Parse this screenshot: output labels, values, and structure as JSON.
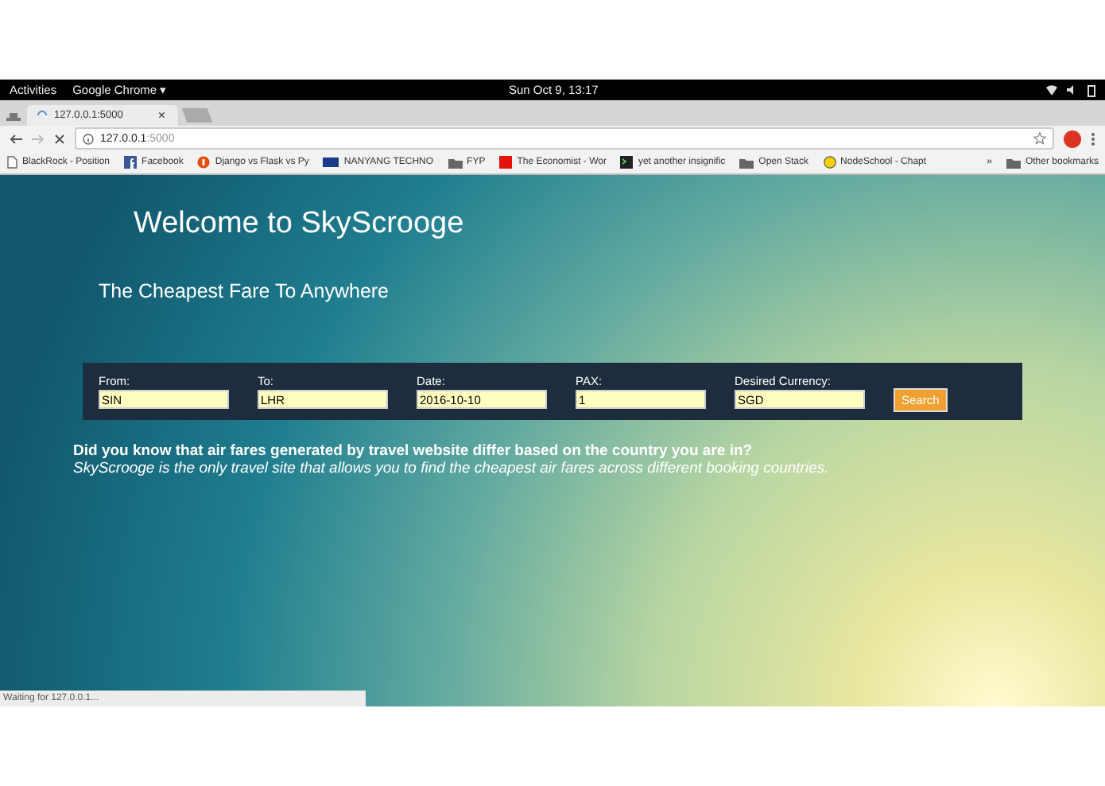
{
  "top_bar": {
    "activities": "Activities",
    "app": "Google Chrome ▾",
    "clock": "Sun Oct  9, 13:17"
  },
  "tabs": [
    {
      "title": "127.0.0.1:5000",
      "close": "×",
      "selected": true
    }
  ],
  "address_bar": {
    "host": "127.0.0.1",
    "port": ":5000"
  },
  "bookmarks": [
    {
      "label": "BlackRock - Position",
      "kind": "page"
    },
    {
      "label": "Facebook",
      "kind": "facebook"
    },
    {
      "label": "Django vs Flask vs Py",
      "kind": "circle"
    },
    {
      "label": "NANYANG TECHNO",
      "kind": "ntu"
    },
    {
      "label": "FYP",
      "kind": "folder"
    },
    {
      "label": "The Economist - Wor",
      "kind": "square"
    },
    {
      "label": "yet another insignific",
      "kind": "terminal"
    },
    {
      "label": "Open Stack",
      "kind": "folder"
    },
    {
      "label": "NodeSchool - Chapt",
      "kind": "dot"
    }
  ],
  "bookmarks_more": "»",
  "other_bookmarks": "Other bookmarks",
  "page": {
    "title": "Welcome to SkyScrooge",
    "subtitle": "The Cheapest Fare To Anywhere",
    "form": {
      "fields": [
        {
          "label": "From:",
          "value": "SIN"
        },
        {
          "label": "To:",
          "value": "LHR"
        },
        {
          "label": "Date:",
          "value": "2016-10-10"
        },
        {
          "label": "PAX:",
          "value": "1"
        },
        {
          "label": "Desired Currency:",
          "value": "SGD"
        }
      ],
      "button": "Search"
    },
    "question": "Did you know that air fares generated by travel website differ based on the country you are in?",
    "tagline": "SkyScrooge is the only travel site that allows you to find the cheapest air fares across different booking countries."
  },
  "status": "Waiting for 127.0.0.1..."
}
